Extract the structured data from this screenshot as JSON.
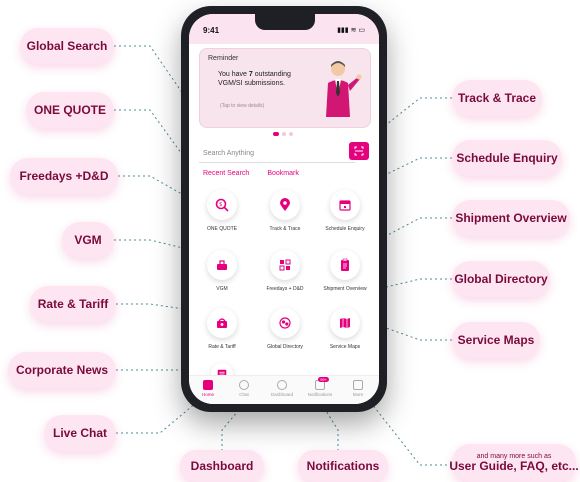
{
  "phone": {
    "time": "9:41",
    "status_icons": "▮▮▮ ≋ ▭",
    "reminder": {
      "title": "Reminder",
      "text_prefix": "You have ",
      "count": "7",
      "text_suffix": " outstanding VGM/SI submissions.",
      "hint": "(Tap to view details)"
    },
    "search_placeholder": "Search Anything",
    "tabs": [
      "Recent Search",
      "Bookmark"
    ],
    "features": [
      {
        "label": "ONE QUOTE",
        "icon": "quote-icon"
      },
      {
        "label": "Track & Trace",
        "icon": "location-pin-icon"
      },
      {
        "label": "Schedule Enquiry",
        "icon": "calendar-icon"
      },
      {
        "label": "VGM",
        "icon": "scale-icon"
      },
      {
        "label": "Freedays + D&D",
        "icon": "grid-icon"
      },
      {
        "label": "Shipment Overview",
        "icon": "clipboard-icon"
      },
      {
        "label": "Rate & Tariff",
        "icon": "rate-icon"
      },
      {
        "label": "Global Directory",
        "icon": "directory-icon"
      },
      {
        "label": "Service Maps",
        "icon": "map-icon"
      },
      {
        "label": "",
        "icon": "news-icon"
      }
    ],
    "nav": [
      {
        "label": "Home",
        "icon": "home-icon"
      },
      {
        "label": "Chat",
        "icon": "chat-icon"
      },
      {
        "label": "Dashboard",
        "icon": "dashboard-icon"
      },
      {
        "label": "Notifications",
        "icon": "bell-icon",
        "badge": "99+"
      },
      {
        "label": "More",
        "icon": "more-icon"
      }
    ]
  },
  "callouts": {
    "global_search": "Global Search",
    "one_quote": "ONE QUOTE",
    "freedays": "Freedays +D&D",
    "vgm": "VGM",
    "rate_tariff": "Rate & Tariff",
    "corporate_news": "Corporate News",
    "live_chat": "Live Chat",
    "dashboard": "Dashboard",
    "notifications": "Notifications",
    "track_trace": "Track & Trace",
    "schedule_enquiry": "Schedule Enquiry",
    "shipment_overview": "Shipment Overview",
    "global_directory": "Global Directory",
    "service_maps": "Service Maps",
    "more_small": "and many more such as",
    "more_big": "User Guide, FAQ, etc..."
  },
  "colors": {
    "accent": "#e6007e",
    "pill_bg": "#fde6f1",
    "pill_text": "#7a0a3c"
  }
}
